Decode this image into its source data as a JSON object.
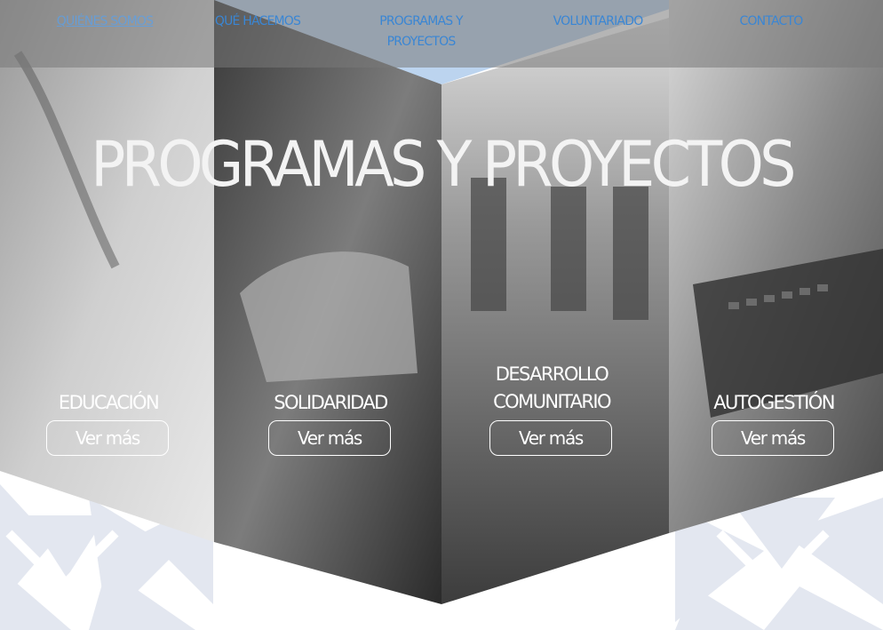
{
  "nav": {
    "items": [
      {
        "label": "QUIÉNES SOMOS"
      },
      {
        "label": "QUÉ HACEMOS"
      },
      {
        "label": "PROGRAMAS Y PROYECTOS"
      },
      {
        "label": "VOLUNTARIADO"
      },
      {
        "label": "CONTACTO"
      }
    ]
  },
  "hero": {
    "title": "PROGRAMAS Y PROYECTOS"
  },
  "categories": [
    {
      "title_line1": "EDUCACIÓN",
      "title_line2": "",
      "button": "Ver más",
      "image": "writing-photo"
    },
    {
      "title_line1": "SOLIDARIDAD",
      "title_line2": "",
      "button": "Ver más",
      "image": "handshake-photo"
    },
    {
      "title_line1": "DESARROLLO",
      "title_line2": "COMUNITARIO",
      "button": "Ver más",
      "image": "people-walking-photo"
    },
    {
      "title_line1": "AUTOGESTIÓN",
      "title_line2": "",
      "button": "Ver más",
      "image": "laptop-photo"
    }
  ],
  "colors": {
    "nav_text": "#3a86d4",
    "nav_bg": "#777777",
    "sky_triangle": "#bcd4ef",
    "pattern": "#dfe4ee"
  }
}
